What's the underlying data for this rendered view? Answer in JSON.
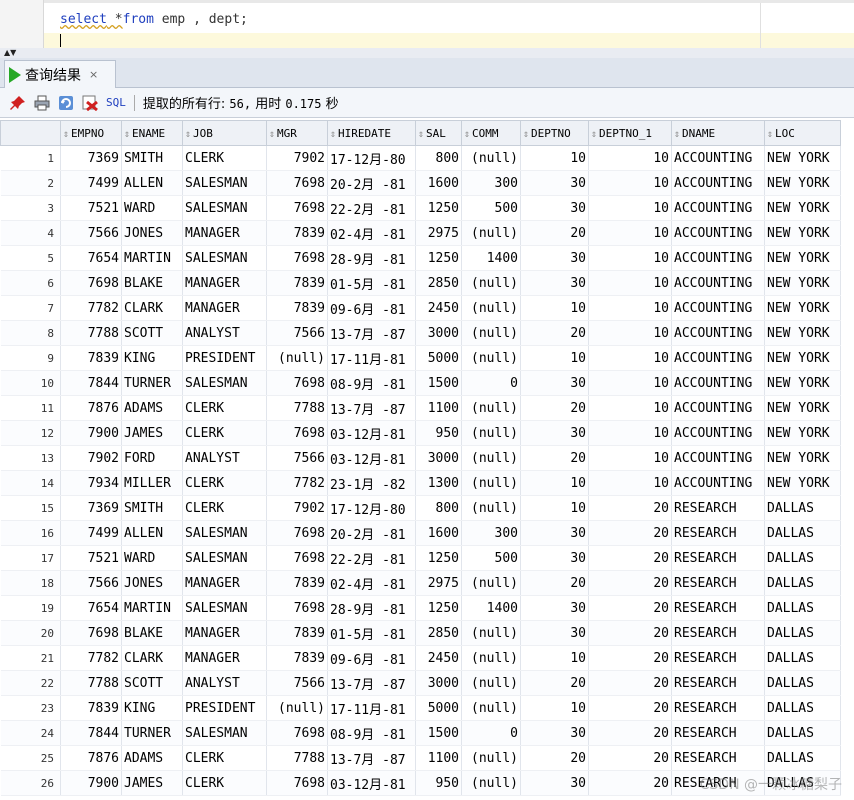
{
  "editor": {
    "kw_select": "select",
    "star": " *",
    "kw_from": "from",
    "rest": " emp , dept;"
  },
  "tab": {
    "label": "查询结果",
    "close": "×"
  },
  "toolbar": {
    "sql_label": "SQL",
    "status_text": "提取的所有行: ",
    "rows": "56,",
    "time_label": " 用时 ",
    "time_value": "0.175",
    "time_unit": " 秒"
  },
  "columns": [
    "EMPNO",
    "ENAME",
    "JOB",
    "MGR",
    "HIREDATE",
    "SAL",
    "COMM",
    "DEPTNO",
    "DEPTNO_1",
    "DNAME",
    "LOC"
  ],
  "rows": [
    [
      "1",
      "7369",
      "SMITH",
      "CLERK",
      "7902",
      "17-12月-80",
      "800",
      "(null)",
      "10",
      "10",
      "ACCOUNTING",
      "NEW YORK"
    ],
    [
      "2",
      "7499",
      "ALLEN",
      "SALESMAN",
      "7698",
      "20-2月 -81",
      "1600",
      "300",
      "30",
      "10",
      "ACCOUNTING",
      "NEW YORK"
    ],
    [
      "3",
      "7521",
      "WARD",
      "SALESMAN",
      "7698",
      "22-2月 -81",
      "1250",
      "500",
      "30",
      "10",
      "ACCOUNTING",
      "NEW YORK"
    ],
    [
      "4",
      "7566",
      "JONES",
      "MANAGER",
      "7839",
      "02-4月 -81",
      "2975",
      "(null)",
      "20",
      "10",
      "ACCOUNTING",
      "NEW YORK"
    ],
    [
      "5",
      "7654",
      "MARTIN",
      "SALESMAN",
      "7698",
      "28-9月 -81",
      "1250",
      "1400",
      "30",
      "10",
      "ACCOUNTING",
      "NEW YORK"
    ],
    [
      "6",
      "7698",
      "BLAKE",
      "MANAGER",
      "7839",
      "01-5月 -81",
      "2850",
      "(null)",
      "30",
      "10",
      "ACCOUNTING",
      "NEW YORK"
    ],
    [
      "7",
      "7782",
      "CLARK",
      "MANAGER",
      "7839",
      "09-6月 -81",
      "2450",
      "(null)",
      "10",
      "10",
      "ACCOUNTING",
      "NEW YORK"
    ],
    [
      "8",
      "7788",
      "SCOTT",
      "ANALYST",
      "7566",
      "13-7月 -87",
      "3000",
      "(null)",
      "20",
      "10",
      "ACCOUNTING",
      "NEW YORK"
    ],
    [
      "9",
      "7839",
      "KING",
      "PRESIDENT",
      "(null)",
      "17-11月-81",
      "5000",
      "(null)",
      "10",
      "10",
      "ACCOUNTING",
      "NEW YORK"
    ],
    [
      "10",
      "7844",
      "TURNER",
      "SALESMAN",
      "7698",
      "08-9月 -81",
      "1500",
      "0",
      "30",
      "10",
      "ACCOUNTING",
      "NEW YORK"
    ],
    [
      "11",
      "7876",
      "ADAMS",
      "CLERK",
      "7788",
      "13-7月 -87",
      "1100",
      "(null)",
      "20",
      "10",
      "ACCOUNTING",
      "NEW YORK"
    ],
    [
      "12",
      "7900",
      "JAMES",
      "CLERK",
      "7698",
      "03-12月-81",
      "950",
      "(null)",
      "30",
      "10",
      "ACCOUNTING",
      "NEW YORK"
    ],
    [
      "13",
      "7902",
      "FORD",
      "ANALYST",
      "7566",
      "03-12月-81",
      "3000",
      "(null)",
      "20",
      "10",
      "ACCOUNTING",
      "NEW YORK"
    ],
    [
      "14",
      "7934",
      "MILLER",
      "CLERK",
      "7782",
      "23-1月 -82",
      "1300",
      "(null)",
      "10",
      "10",
      "ACCOUNTING",
      "NEW YORK"
    ],
    [
      "15",
      "7369",
      "SMITH",
      "CLERK",
      "7902",
      "17-12月-80",
      "800",
      "(null)",
      "10",
      "20",
      "RESEARCH",
      "DALLAS"
    ],
    [
      "16",
      "7499",
      "ALLEN",
      "SALESMAN",
      "7698",
      "20-2月 -81",
      "1600",
      "300",
      "30",
      "20",
      "RESEARCH",
      "DALLAS"
    ],
    [
      "17",
      "7521",
      "WARD",
      "SALESMAN",
      "7698",
      "22-2月 -81",
      "1250",
      "500",
      "30",
      "20",
      "RESEARCH",
      "DALLAS"
    ],
    [
      "18",
      "7566",
      "JONES",
      "MANAGER",
      "7839",
      "02-4月 -81",
      "2975",
      "(null)",
      "20",
      "20",
      "RESEARCH",
      "DALLAS"
    ],
    [
      "19",
      "7654",
      "MARTIN",
      "SALESMAN",
      "7698",
      "28-9月 -81",
      "1250",
      "1400",
      "30",
      "20",
      "RESEARCH",
      "DALLAS"
    ],
    [
      "20",
      "7698",
      "BLAKE",
      "MANAGER",
      "7839",
      "01-5月 -81",
      "2850",
      "(null)",
      "30",
      "20",
      "RESEARCH",
      "DALLAS"
    ],
    [
      "21",
      "7782",
      "CLARK",
      "MANAGER",
      "7839",
      "09-6月 -81",
      "2450",
      "(null)",
      "10",
      "20",
      "RESEARCH",
      "DALLAS"
    ],
    [
      "22",
      "7788",
      "SCOTT",
      "ANALYST",
      "7566",
      "13-7月 -87",
      "3000",
      "(null)",
      "20",
      "20",
      "RESEARCH",
      "DALLAS"
    ],
    [
      "23",
      "7839",
      "KING",
      "PRESIDENT",
      "(null)",
      "17-11月-81",
      "5000",
      "(null)",
      "10",
      "20",
      "RESEARCH",
      "DALLAS"
    ],
    [
      "24",
      "7844",
      "TURNER",
      "SALESMAN",
      "7698",
      "08-9月 -81",
      "1500",
      "0",
      "30",
      "20",
      "RESEARCH",
      "DALLAS"
    ],
    [
      "25",
      "7876",
      "ADAMS",
      "CLERK",
      "7788",
      "13-7月 -87",
      "1100",
      "(null)",
      "20",
      "20",
      "RESEARCH",
      "DALLAS"
    ],
    [
      "26",
      "7900",
      "JAMES",
      "CLERK",
      "7698",
      "03-12月-81",
      "950",
      "(null)",
      "30",
      "20",
      "RESEARCH",
      "DALLAS"
    ]
  ],
  "watermark": "CSDN @一颗冰糖梨子"
}
